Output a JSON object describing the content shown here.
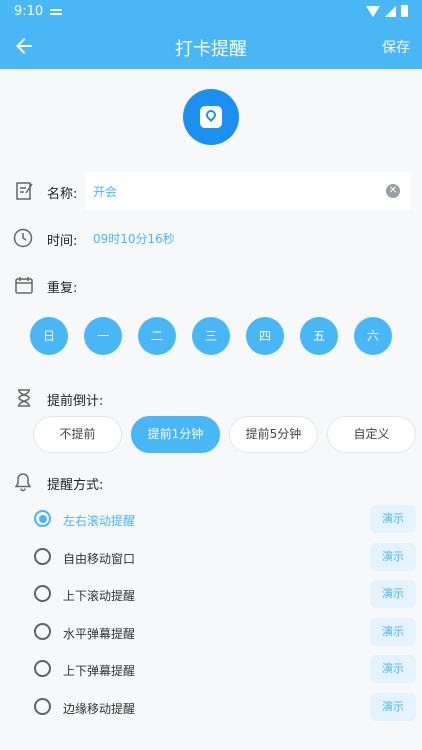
{
  "status_bar": {
    "time": "9:10"
  },
  "app_bar": {
    "title": "打卡提醒",
    "save_label": "保存"
  },
  "name": {
    "label": "名称:",
    "value": "开会"
  },
  "time": {
    "label": "时间:",
    "value": "09时10分16秒"
  },
  "repeat": {
    "label": "重复:",
    "days": [
      "日",
      "一",
      "二",
      "三",
      "四",
      "五",
      "六"
    ]
  },
  "countdown": {
    "label": "提前倒计:",
    "options": [
      "不提前",
      "提前1分钟",
      "提前5分钟",
      "自定义"
    ],
    "selected_index": 1
  },
  "method": {
    "label": "提醒方式:",
    "options": [
      "左右滚动提醒",
      "自由移动窗口",
      "上下滚动提醒",
      "水平弹幕提醒",
      "上下弹幕提醒",
      "边缘移动提醒"
    ],
    "selected_index": 0,
    "demo_label": "演示"
  },
  "colors": {
    "accent": "#49b6f5",
    "logo": "#1c90f0",
    "demo_bg": "#e4f3fd"
  }
}
